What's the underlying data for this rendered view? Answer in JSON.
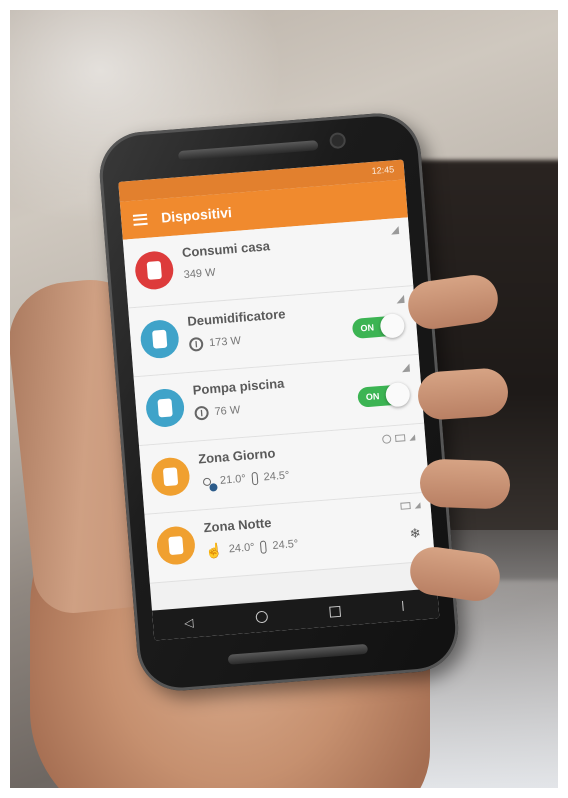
{
  "status_bar": {
    "text": "12:45"
  },
  "app": {
    "title": "Dispositivi"
  },
  "devices": [
    {
      "name": "Consumi casa",
      "value": "349 W",
      "icon_color": "#dd3b3b",
      "icon": "power-meter-icon"
    },
    {
      "name": "Deumidificatore",
      "value": "173 W",
      "icon_color": "#3fa3c9",
      "icon": "dehumidifier-icon",
      "toggle": "ON"
    },
    {
      "name": "Pompa piscina",
      "value": "76 W",
      "icon_color": "#3fa3c9",
      "icon": "pool-pump-icon",
      "toggle": "ON"
    },
    {
      "name": "Zona Giorno",
      "temp_current": "21.0°",
      "temp_set": "24.5°",
      "icon_color": "#f0a030",
      "icon": "thermostat-icon"
    },
    {
      "name": "Zona Notte",
      "temp_current": "24.0°",
      "temp_set": "24.5°",
      "icon_color": "#f0a030",
      "icon": "thermostat-icon"
    }
  ],
  "colors": {
    "appbar": "#f08a2e",
    "toggle_on": "#3cb453"
  }
}
